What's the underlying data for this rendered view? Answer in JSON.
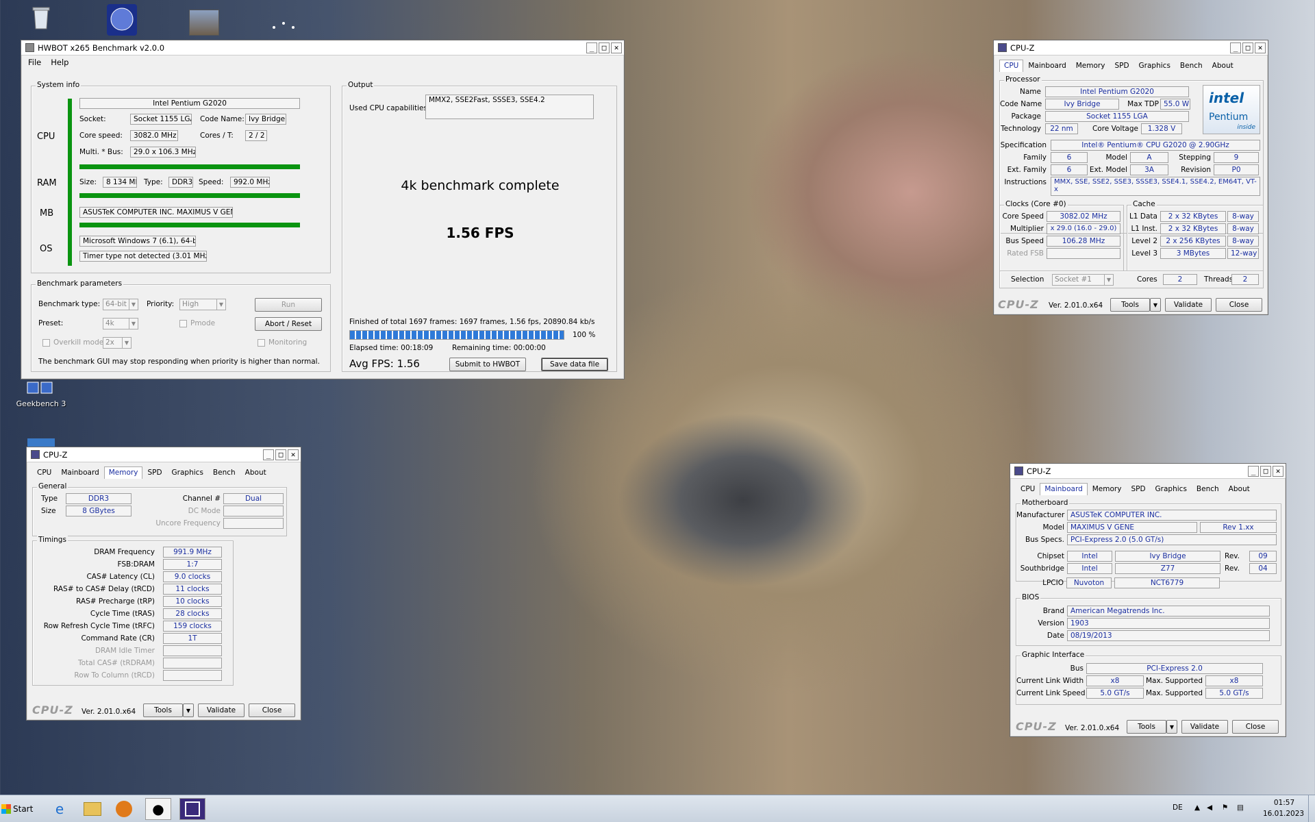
{
  "desktop": {
    "geekbench_label": "Geekbench 3"
  },
  "hwbot": {
    "title": "HWBOT x265 Benchmark v2.0.0",
    "menu": [
      "File",
      "Help"
    ],
    "sysinfo": {
      "legend": "System info",
      "cpu_label": "CPU",
      "ram_label": "RAM",
      "mb_label": "MB",
      "os_label": "OS",
      "cpu_name": "Intel Pentium G2020",
      "socket_lbl": "Socket:",
      "socket": "Socket 1155 LGA",
      "codename_lbl": "Code Name:",
      "codename": "Ivy Bridge",
      "corespeed_lbl": "Core speed:",
      "corespeed": "3082.0 MHz",
      "cores_lbl": "Cores / T:",
      "cores": "2 / 2",
      "multi_lbl": "Multi. * Bus:",
      "multi": "29.0 x 106.3 MHz",
      "size_lbl": "Size:",
      "size": "8 134 MB",
      "type_lbl": "Type:",
      "type": "DDR3",
      "speed_lbl": "Speed:",
      "speed": "992.0 MHz",
      "mb": "ASUSTeK COMPUTER INC. MAXIMUS V GENE",
      "os": "Microsoft Windows 7 (6.1), 64-bit",
      "timer": "Timer type not detected (3.01 MHz )"
    },
    "output": {
      "legend": "Output",
      "caps_lbl": "Used CPU capabilities:",
      "caps": "MMX2, SSE2Fast, SSSE3, SSE4.2",
      "complete": "4k benchmark complete",
      "fps": "1.56 FPS",
      "finished": "Finished of total 1697 frames: 1697 frames, 1.56 fps,  20890.84 kb/s",
      "progress": 1.0,
      "progress_pct": "100 %",
      "elapsed": "Elapsed time: 00:18:09",
      "remaining": "Remaining time: 00:00:00",
      "avg": "Avg FPS: 1.56",
      "submit": "Submit to HWBOT",
      "save": "Save data file"
    },
    "params": {
      "legend": "Benchmark parameters",
      "type_lbl": "Benchmark type:",
      "type": "64-bit",
      "priority_lbl": "Priority:",
      "priority": "High",
      "run": "Run",
      "preset_lbl": "Preset:",
      "preset": "4k",
      "pmode": "Pmode",
      "abort": "Abort / Reset",
      "overkill": "Overkill mode",
      "overkill_val": "2x",
      "monitoring": "Monitoring",
      "note": "The benchmark GUI may stop responding when priority is higher than normal."
    }
  },
  "cpuz_tabs": [
    "CPU",
    "Mainboard",
    "Memory",
    "SPD",
    "Graphics",
    "Bench",
    "About"
  ],
  "cpuz_common": {
    "title": "CPU-Z",
    "logo": "CPU-Z",
    "version": "Ver. 2.01.0.x64",
    "tools": "Tools",
    "validate": "Validate",
    "close": "Close"
  },
  "cpuz_cpu": {
    "processor_lg": "Processor",
    "name_l": "Name",
    "name": "Intel Pentium G2020",
    "codename_l": "Code Name",
    "codename": "Ivy Bridge",
    "tdp_l": "Max TDP",
    "tdp": "55.0 W",
    "package_l": "Package",
    "package": "Socket 1155 LGA",
    "tech_l": "Technology",
    "tech": "22 nm",
    "voltage_l": "Core Voltage",
    "voltage": "1.328 V",
    "spec_l": "Specification",
    "spec": "Intel® Pentium® CPU G2020 @ 2.90GHz",
    "family_l": "Family",
    "family": "6",
    "model_l": "Model",
    "model": "A",
    "stepping_l": "Stepping",
    "stepping": "9",
    "extfam_l": "Ext. Family",
    "extfam": "6",
    "extmod_l": "Ext. Model",
    "extmod": "3A",
    "revision_l": "Revision",
    "revision": "P0",
    "instr_l": "Instructions",
    "instr": "MMX, SSE, SSE2, SSE3, SSSE3, SSE4.1, SSE4.2, EM64T, VT-x",
    "clocks_lg": "Clocks (Core #0)",
    "cspeed_l": "Core Speed",
    "cspeed": "3082.02 MHz",
    "mult_l": "Multiplier",
    "mult": "x 29.0 (16.0 - 29.0)",
    "bus_l": "Bus Speed",
    "bus": "106.28 MHz",
    "fsb_l": "Rated FSB",
    "cache_lg": "Cache",
    "l1d_l": "L1 Data",
    "l1d": "2 x 32 KBytes",
    "l1d_w": "8-way",
    "l1i_l": "L1 Inst.",
    "l1i": "2 x 32 KBytes",
    "l1i_w": "8-way",
    "l2_l": "Level 2",
    "l2": "2 x 256 KBytes",
    "l2_w": "8-way",
    "l3_l": "Level 3",
    "l3": "3 MBytes",
    "l3_w": "12-way",
    "selection_l": "Selection",
    "selection": "Socket #1",
    "cores_l": "Cores",
    "cores": "2",
    "threads_l": "Threads",
    "threads": "2",
    "badge_brand": "intel",
    "badge_model": "Pentium",
    "badge_inside": "inside"
  },
  "cpuz_mem": {
    "general_lg": "General",
    "type_l": "Type",
    "type": "DDR3",
    "size_l": "Size",
    "size": "8 GBytes",
    "channel_l": "Channel #",
    "channel": "Dual",
    "dc_l": "DC Mode",
    "uncore_l": "Uncore Frequency",
    "timings_lg": "Timings",
    "rows": [
      {
        "l": "DRAM Frequency",
        "v": "991.9 MHz"
      },
      {
        "l": "FSB:DRAM",
        "v": "1:7"
      },
      {
        "l": "CAS# Latency (CL)",
        "v": "9.0 clocks"
      },
      {
        "l": "RAS# to CAS# Delay (tRCD)",
        "v": "11 clocks"
      },
      {
        "l": "RAS# Precharge (tRP)",
        "v": "10 clocks"
      },
      {
        "l": "Cycle Time (tRAS)",
        "v": "28 clocks"
      },
      {
        "l": "Row Refresh Cycle Time (tRFC)",
        "v": "159 clocks"
      },
      {
        "l": "Command Rate (CR)",
        "v": "1T"
      },
      {
        "l": "DRAM Idle Timer",
        "v": ""
      },
      {
        "l": "Total CAS# (tRDRAM)",
        "v": ""
      },
      {
        "l": "Row To Column (tRCD)",
        "v": ""
      }
    ]
  },
  "cpuz_mb": {
    "mb_lg": "Motherboard",
    "manu_l": "Manufacturer",
    "manu": "ASUSTeK COMPUTER INC.",
    "model_l": "Model",
    "model": "MAXIMUS V GENE",
    "rev": "Rev 1.xx",
    "busspec_l": "Bus Specs.",
    "busspec": "PCI-Express 2.0 (5.0 GT/s)",
    "chipset_l": "Chipset",
    "chipset_v": "Intel",
    "chipset_n": "Ivy Bridge",
    "rev_l": "Rev.",
    "chipset_r": "09",
    "south_l": "Southbridge",
    "south_v": "Intel",
    "south_n": "Z77",
    "south_r": "04",
    "lpcio_l": "LPCIO",
    "lpcio_v": "Nuvoton",
    "lpcio_n": "NCT6779",
    "bios_lg": "BIOS",
    "brand_l": "Brand",
    "brand": "American Megatrends Inc.",
    "version_l": "Version",
    "version": "1903",
    "date_l": "Date",
    "date": "08/19/2013",
    "gi_lg": "Graphic Interface",
    "gbus_l": "Bus",
    "gbus": "PCI-Express 2.0",
    "clw_l": "Current Link Width",
    "clw": "x8",
    "msup_l": "Max. Supported",
    "msw": "x8",
    "cls_l": "Current Link Speed",
    "cls": "5.0 GT/s",
    "mss": "5.0 GT/s"
  },
  "taskbar": {
    "start": "Start",
    "lang": "DE",
    "time": "01:57",
    "date": "16.01.2023"
  }
}
